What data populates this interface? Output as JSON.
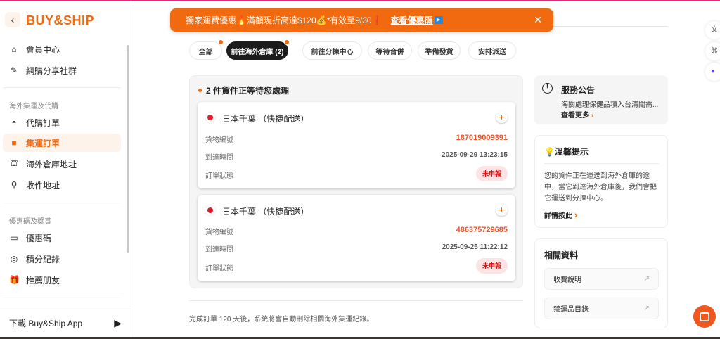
{
  "brand": {
    "logo": "BUY&SHIP"
  },
  "sidebar": {
    "items_top": [
      {
        "label": "會員中心",
        "icon": "home-icon"
      },
      {
        "label": "網購分享社群",
        "icon": "edit-icon"
      }
    ],
    "section1": "海外集運及代購",
    "items1": [
      {
        "label": "代購訂單",
        "icon": "bag-icon"
      },
      {
        "label": "集運訂單",
        "icon": "box-icon",
        "active": true
      },
      {
        "label": "海外倉庫地址",
        "icon": "warehouse-icon"
      },
      {
        "label": "收件地址",
        "icon": "location-icon"
      }
    ],
    "section2": "優惠碼及獎賞",
    "items2": [
      {
        "label": "優惠碼",
        "icon": "coupon-icon"
      },
      {
        "label": "積分紀錄",
        "icon": "points-icon"
      },
      {
        "label": "推薦朋友",
        "icon": "gift-icon"
      }
    ],
    "app_label": "下載 Buy&Ship App"
  },
  "banner": {
    "text": "獨家運費優惠🔥滿額現折高達$120💰*有效至9/30❗",
    "link": "查看優惠碼",
    "color": "#f26a0f"
  },
  "tabs": [
    {
      "label": "全部"
    },
    {
      "label": "前往海外倉庫 (2)",
      "active": true
    },
    {
      "label": "前往分揀中心"
    },
    {
      "label": "等待合併"
    },
    {
      "label": "準備發貨"
    },
    {
      "label": "安排派送"
    }
  ],
  "panel": {
    "title": "2 件貨件正等待您處理",
    "labels": {
      "id": "貨物編號",
      "arrival": "到達時間",
      "status": "訂單狀態"
    },
    "orders": [
      {
        "location": "日本千葉 （快捷配送）",
        "id": "187019009391",
        "arrival": "2025-09-29 13:23:15",
        "status": "未申報"
      },
      {
        "location": "日本千葉 （快捷配送）",
        "id": "486375729685",
        "arrival": "2025-09-25 11:22:12",
        "status": "未申報"
      }
    ]
  },
  "footer_note": "完成訂單 120 天後，系統將會自動刪除相關海外集運紀錄。",
  "notice": {
    "title": "服務公告",
    "text": "海關處理保健品項入台清關需...",
    "more": "查看更多"
  },
  "tips": {
    "title": "💡溫馨提示",
    "body": "您的貨件正在運送到海外倉庫的途中，當它到達海外倉庫後，我們會把它運送到分揀中心。",
    "more": "詳情按此"
  },
  "related": {
    "title": "相關資料",
    "links": [
      "收費說明",
      "禁運品目錄"
    ]
  }
}
